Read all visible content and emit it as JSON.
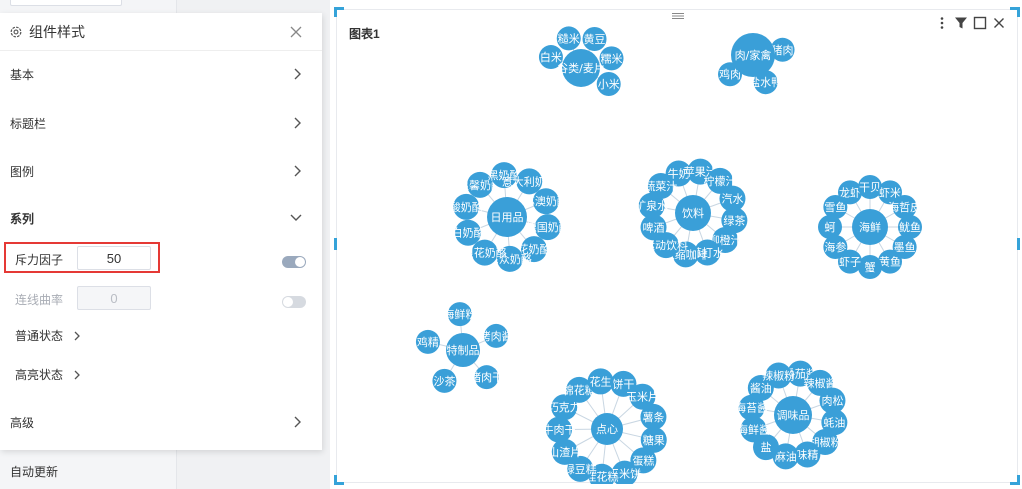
{
  "background": {
    "auto_update_label": "自动更新"
  },
  "panel": {
    "title": "组件样式",
    "sections": {
      "basic": "基本",
      "titlebar": "标题栏",
      "legend": "图例",
      "series": "系列",
      "advanced": "高级"
    },
    "repulsion": {
      "label": "斥力因子",
      "value": "50"
    },
    "curvature": {
      "label": "连线曲率",
      "value": "0"
    },
    "normal_state": "普通状态",
    "highlight_state": "高亮状态"
  },
  "chart": {
    "title": "图表1",
    "node_color": "#3a9fd8",
    "link_color": "#c8d6e2",
    "label_color": "#ffffff",
    "groups": [
      {
        "name": "谷类/麦片",
        "children": [
          "白米",
          "糙米",
          "黄豆",
          "糯米",
          "小米"
        ]
      },
      {
        "name": "肉/家禽",
        "children": [
          "猪肉",
          "盐水鸭",
          "鸡肉"
        ]
      },
      {
        "name": "日用品",
        "children": [
          "温馨奶酪",
          "黑奶酪",
          "意大利奶酪",
          "苏澳奶酪",
          "德国奶酪",
          "花奶酪",
          "民众奶酪",
          "浪花奶酪",
          "白奶酪",
          "酸奶酪"
        ]
      },
      {
        "name": "饮料",
        "children": [
          "牛奶",
          "苹果汁",
          "柠檬汁",
          "汽水",
          "绿茶",
          "柳橙汁",
          "苏打水",
          "浓缩咖啡",
          "运动饮料",
          "啤酒",
          "矿泉水",
          "蔬菜汁"
        ]
      },
      {
        "name": "海鲜",
        "children": [
          "龙虾",
          "干贝",
          "虾米",
          "海哲皮",
          "鱿鱼",
          "墨鱼",
          "黄鱼",
          "蟹",
          "虾子",
          "海参",
          "蚵",
          "雪鱼"
        ]
      },
      {
        "name": "特制品",
        "children": [
          "海鲜粉",
          "烤肉酱",
          "猪肉干",
          "沙茶",
          "鸡精"
        ]
      },
      {
        "name": "点心",
        "children": [
          "饼干",
          "玉米片",
          "薯条",
          "糖果",
          "蛋糕",
          "玉米饼",
          "桂花糕",
          "绿豆糕",
          "山渣片",
          "牛肉干",
          "巧克力",
          "棉花糖",
          "花生"
        ]
      },
      {
        "name": "调味品",
        "children": [
          "番茄酱",
          "辣椒酱",
          "肉松",
          "蚝油",
          "胡椒粉",
          "味精",
          "麻油",
          "盐",
          "海鲜酱",
          "海苔酱",
          "酱油",
          "辣椒粉"
        ]
      }
    ]
  }
}
